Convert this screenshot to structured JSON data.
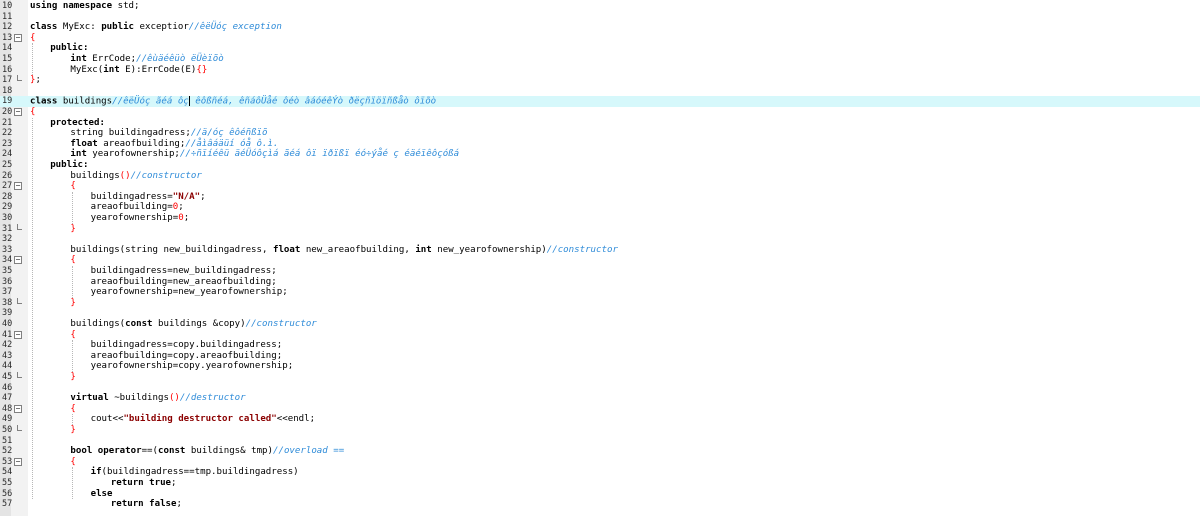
{
  "editor": {
    "lines": [
      {
        "n": "10",
        "fold": "",
        "current": false,
        "indent": 0,
        "segs": [
          [
            "kw",
            "using namespace"
          ],
          [
            "t",
            " std;"
          ]
        ]
      },
      {
        "n": "11",
        "fold": "",
        "current": false,
        "indent": 0,
        "segs": []
      },
      {
        "n": "12",
        "fold": "",
        "current": false,
        "indent": 0,
        "segs": [
          [
            "kw",
            "class"
          ],
          [
            "t",
            " MyExc: "
          ],
          [
            "kw",
            "public"
          ],
          [
            "t",
            " exceptior"
          ],
          [
            "cm",
            "//êëÜóç exception"
          ]
        ]
      },
      {
        "n": "13",
        "fold": "minus",
        "current": false,
        "indent": 0,
        "segs": [
          [
            "br",
            "{"
          ]
        ]
      },
      {
        "n": "14",
        "fold": "",
        "current": false,
        "indent": 2,
        "segs": [
          [
            "kw",
            "public:"
          ]
        ]
      },
      {
        "n": "15",
        "fold": "",
        "current": false,
        "indent": 4,
        "segs": [
          [
            "kw",
            "int"
          ],
          [
            "t",
            " ErrCode;"
          ],
          [
            "cm",
            "//êùäéêüò ëÜèïõò"
          ]
        ]
      },
      {
        "n": "16",
        "fold": "",
        "current": false,
        "indent": 4,
        "segs": [
          [
            "t",
            "MyExc("
          ],
          [
            "kw",
            "int"
          ],
          [
            "t",
            " E):ErrCode(E)"
          ],
          [
            "br",
            "{}"
          ]
        ]
      },
      {
        "n": "17",
        "fold": "end",
        "current": false,
        "indent": 0,
        "segs": [
          [
            "br",
            "}"
          ],
          [
            "t",
            ";"
          ]
        ]
      },
      {
        "n": "18",
        "fold": "",
        "current": false,
        "indent": 0,
        "segs": []
      },
      {
        "n": "19",
        "fold": "",
        "current": true,
        "indent": 0,
        "segs": [
          [
            "kw",
            "class"
          ],
          [
            "t",
            " buildings"
          ],
          [
            "cm",
            "//êëÜóç ãéá ôç"
          ],
          [
            "caret",
            ""
          ],
          [
            "cm",
            " êôßñéá, êñáôÜåé ôéò âáóéêÝò ðëçñïöïñßåò ôïõò"
          ]
        ]
      },
      {
        "n": "20",
        "fold": "minus",
        "current": false,
        "indent": 0,
        "segs": [
          [
            "br",
            "{"
          ]
        ]
      },
      {
        "n": "21",
        "fold": "",
        "current": false,
        "indent": 2,
        "segs": [
          [
            "kw",
            "protected:"
          ]
        ]
      },
      {
        "n": "22",
        "fold": "",
        "current": false,
        "indent": 4,
        "segs": [
          [
            "t",
            "string buildingadress;"
          ],
          [
            "cm",
            "//ä/óç êôéñßïõ"
          ]
        ]
      },
      {
        "n": "23",
        "fold": "",
        "current": false,
        "indent": 4,
        "segs": [
          [
            "kw",
            "float"
          ],
          [
            "t",
            " areaofbuilding;"
          ],
          [
            "cm",
            "//åìâáäüí óå ô.ì."
          ]
        ]
      },
      {
        "n": "24",
        "fold": "",
        "current": false,
        "indent": 4,
        "segs": [
          [
            "kw",
            "int"
          ],
          [
            "t",
            " yearofownership;"
          ],
          [
            "cm",
            "//÷ñïíéêü äéÜóôçìá ãéá ôï ïðïßï éó÷ýåé ç éäéïêôçóßá"
          ]
        ]
      },
      {
        "n": "25",
        "fold": "",
        "current": false,
        "indent": 2,
        "segs": [
          [
            "kw",
            "public:"
          ]
        ]
      },
      {
        "n": "26",
        "fold": "",
        "current": false,
        "indent": 4,
        "segs": [
          [
            "t",
            "buildings"
          ],
          [
            "br",
            "()"
          ],
          [
            "cm",
            "//constructor"
          ]
        ]
      },
      {
        "n": "27",
        "fold": "minus",
        "current": false,
        "indent": 4,
        "segs": [
          [
            "br",
            "{"
          ]
        ]
      },
      {
        "n": "28",
        "fold": "",
        "current": false,
        "indent": 6,
        "segs": [
          [
            "t",
            "buildingadress="
          ],
          [
            "str",
            "\"N/A\""
          ],
          [
            "t",
            ";"
          ]
        ]
      },
      {
        "n": "29",
        "fold": "",
        "current": false,
        "indent": 6,
        "segs": [
          [
            "t",
            "areaofbuilding="
          ],
          [
            "num",
            "0"
          ],
          [
            "t",
            ";"
          ]
        ]
      },
      {
        "n": "30",
        "fold": "",
        "current": false,
        "indent": 6,
        "segs": [
          [
            "t",
            "yearofownership="
          ],
          [
            "num",
            "0"
          ],
          [
            "t",
            ";"
          ]
        ]
      },
      {
        "n": "31",
        "fold": "end",
        "current": false,
        "indent": 4,
        "segs": [
          [
            "br",
            "}"
          ]
        ]
      },
      {
        "n": "32",
        "fold": "",
        "current": false,
        "indent": 0,
        "segs": []
      },
      {
        "n": "33",
        "fold": "",
        "current": false,
        "indent": 4,
        "segs": [
          [
            "t",
            "buildings(string new_buildingadress, "
          ],
          [
            "kw",
            "float"
          ],
          [
            "t",
            " new_areaofbuilding, "
          ],
          [
            "kw",
            "int"
          ],
          [
            "t",
            " new_yearofownership)"
          ],
          [
            "cm",
            "//constructor"
          ]
        ]
      },
      {
        "n": "34",
        "fold": "minus",
        "current": false,
        "indent": 4,
        "segs": [
          [
            "br",
            "{"
          ]
        ]
      },
      {
        "n": "35",
        "fold": "",
        "current": false,
        "indent": 6,
        "segs": [
          [
            "t",
            "buildingadress=new_buildingadress;"
          ]
        ]
      },
      {
        "n": "36",
        "fold": "",
        "current": false,
        "indent": 6,
        "segs": [
          [
            "t",
            "areaofbuilding=new_areaofbuilding;"
          ]
        ]
      },
      {
        "n": "37",
        "fold": "",
        "current": false,
        "indent": 6,
        "segs": [
          [
            "t",
            "yearofownership=new_yearofownership;"
          ]
        ]
      },
      {
        "n": "38",
        "fold": "end",
        "current": false,
        "indent": 4,
        "segs": [
          [
            "br",
            "}"
          ]
        ]
      },
      {
        "n": "39",
        "fold": "",
        "current": false,
        "indent": 0,
        "segs": []
      },
      {
        "n": "40",
        "fold": "",
        "current": false,
        "indent": 4,
        "segs": [
          [
            "t",
            "buildings("
          ],
          [
            "kw",
            "const"
          ],
          [
            "t",
            " buildings &copy)"
          ],
          [
            "cm",
            "//constructor"
          ]
        ]
      },
      {
        "n": "41",
        "fold": "minus",
        "current": false,
        "indent": 4,
        "segs": [
          [
            "br",
            "{"
          ]
        ]
      },
      {
        "n": "42",
        "fold": "",
        "current": false,
        "indent": 6,
        "segs": [
          [
            "t",
            "buildingadress=copy.buildingadress;"
          ]
        ]
      },
      {
        "n": "43",
        "fold": "",
        "current": false,
        "indent": 6,
        "segs": [
          [
            "t",
            "areaofbuilding=copy.areaofbuilding;"
          ]
        ]
      },
      {
        "n": "44",
        "fold": "",
        "current": false,
        "indent": 6,
        "segs": [
          [
            "t",
            "yearofownership=copy.yearofownership;"
          ]
        ]
      },
      {
        "n": "45",
        "fold": "end",
        "current": false,
        "indent": 4,
        "segs": [
          [
            "br",
            "}"
          ]
        ]
      },
      {
        "n": "46",
        "fold": "",
        "current": false,
        "indent": 0,
        "segs": []
      },
      {
        "n": "47",
        "fold": "",
        "current": false,
        "indent": 4,
        "segs": [
          [
            "kw",
            "virtual"
          ],
          [
            "t",
            " ~buildings"
          ],
          [
            "br",
            "()"
          ],
          [
            "cm",
            "//destructor"
          ]
        ]
      },
      {
        "n": "48",
        "fold": "minus",
        "current": false,
        "indent": 4,
        "segs": [
          [
            "br",
            "{"
          ]
        ]
      },
      {
        "n": "49",
        "fold": "",
        "current": false,
        "indent": 6,
        "segs": [
          [
            "t",
            "cout<<"
          ],
          [
            "str",
            "\"building destructor called\""
          ],
          [
            "t",
            "<<endl;"
          ]
        ]
      },
      {
        "n": "50",
        "fold": "end",
        "current": false,
        "indent": 4,
        "segs": [
          [
            "br",
            "}"
          ]
        ]
      },
      {
        "n": "51",
        "fold": "",
        "current": false,
        "indent": 0,
        "segs": []
      },
      {
        "n": "52",
        "fold": "",
        "current": false,
        "indent": 4,
        "segs": [
          [
            "kw",
            "bool operator"
          ],
          [
            "t",
            "==("
          ],
          [
            "kw",
            "const"
          ],
          [
            "t",
            " buildings& tmp)"
          ],
          [
            "cm",
            "//overload =="
          ]
        ]
      },
      {
        "n": "53",
        "fold": "minus",
        "current": false,
        "indent": 4,
        "segs": [
          [
            "br",
            "{"
          ]
        ]
      },
      {
        "n": "54",
        "fold": "",
        "current": false,
        "indent": 6,
        "segs": [
          [
            "kw",
            "if"
          ],
          [
            "t",
            "(buildingadress==tmp.buildingadress)"
          ]
        ]
      },
      {
        "n": "55",
        "fold": "",
        "current": false,
        "indent": 8,
        "segs": [
          [
            "kw",
            "return true"
          ],
          [
            "t",
            ";"
          ]
        ]
      },
      {
        "n": "56",
        "fold": "",
        "current": false,
        "indent": 6,
        "segs": [
          [
            "kw",
            "else"
          ]
        ]
      },
      {
        "n": "57",
        "fold": "",
        "current": false,
        "indent": 8,
        "segs": [
          [
            "kw",
            "return false"
          ],
          [
            "t",
            ";"
          ]
        ]
      }
    ]
  }
}
